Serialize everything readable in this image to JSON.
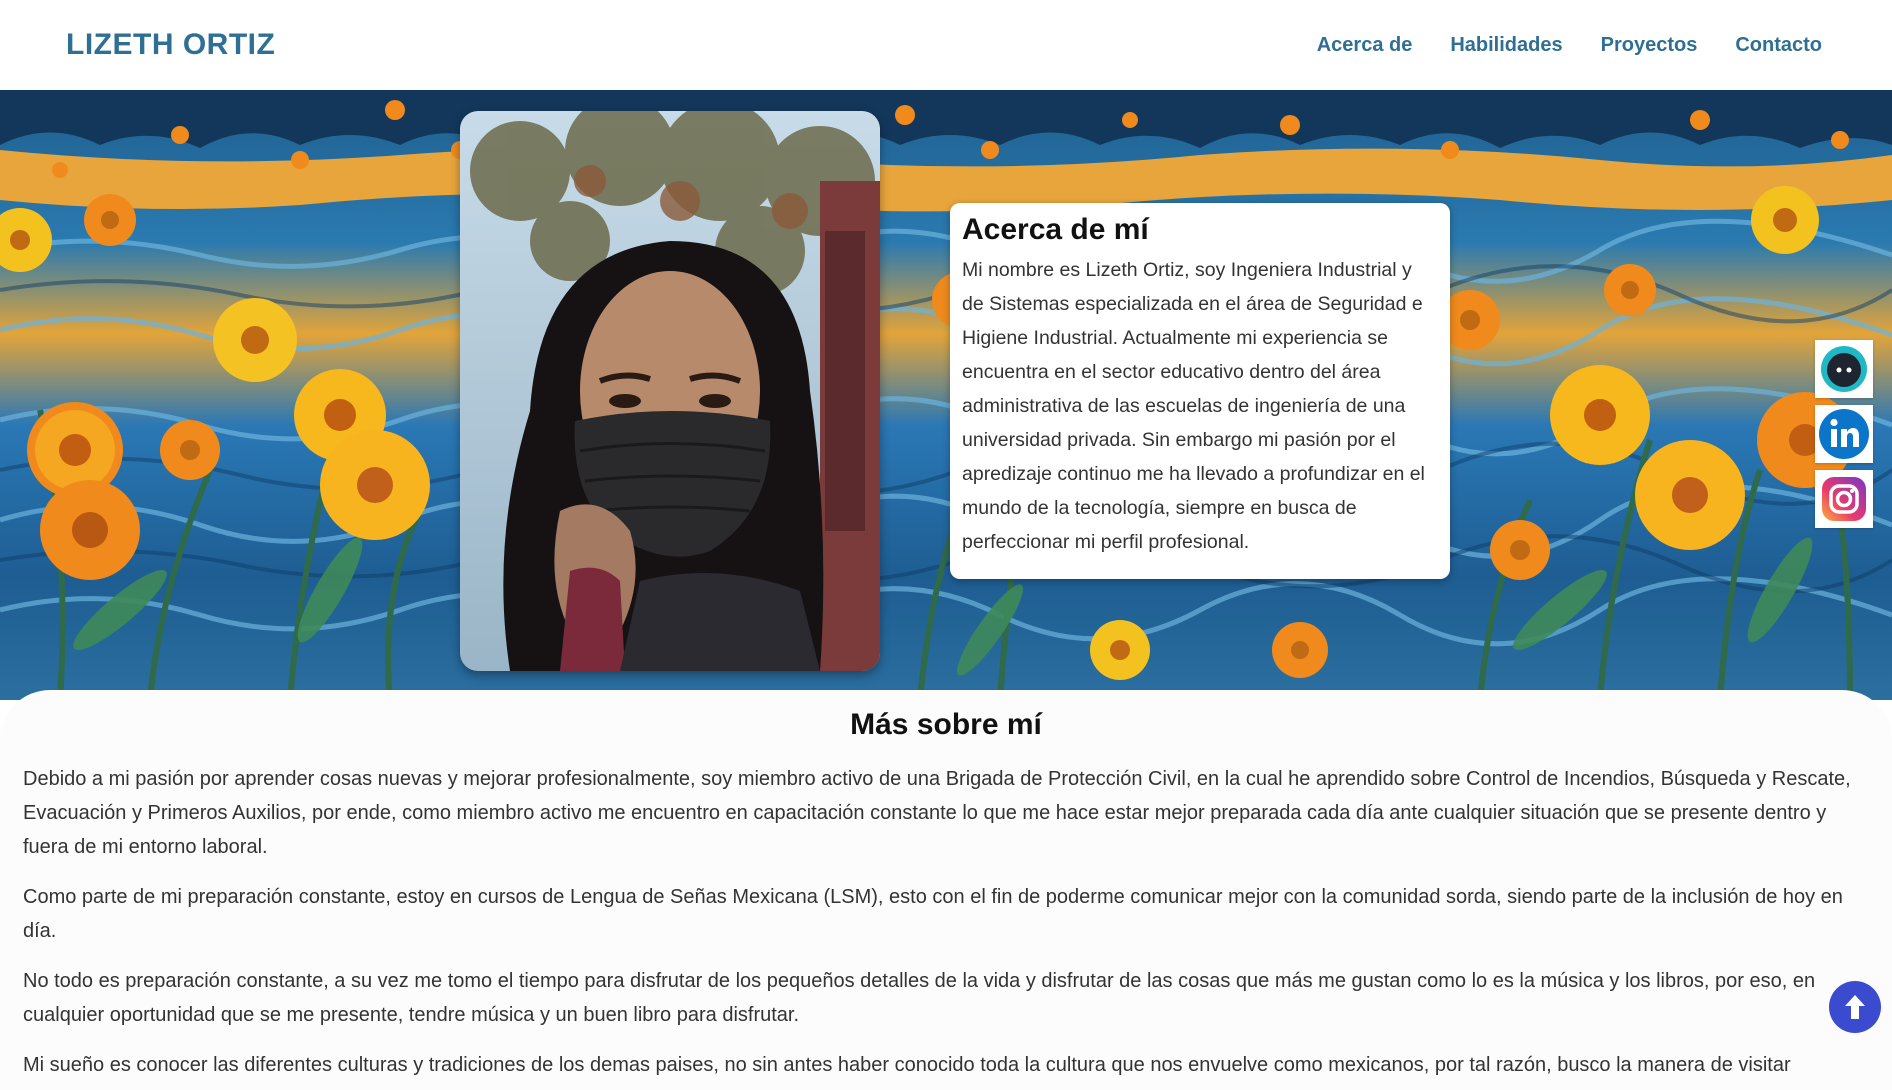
{
  "header": {
    "brand": "LIZETH ORTIZ",
    "nav": [
      "Acerca de",
      "Habilidades",
      "Proyectos",
      "Contacto"
    ]
  },
  "about": {
    "title": "Acerca de mí",
    "text": "Mi nombre es Lizeth Ortiz, soy Ingeniera Industrial y de Sistemas especializada en el área de Seguridad e Higiene Industrial. Actualmente mi experiencia se encuentra en el sector educativo dentro del área administrativa de las escuelas de ingeniería de una universidad privada. Sin embargo mi pasión por el apredizaje continuo me ha llevado a profundizar en el mundo de la tecnología, siempre en busca de perfeccionar mi perfil profesional."
  },
  "more": {
    "title": "Más sobre mí",
    "paragraphs": [
      "Debido a mi pasión por aprender cosas nuevas y mejorar profesionalmente, soy miembro activo de una Brigada de Protección Civil, en la cual he aprendido sobre Control de Incendios, Búsqueda y Rescate, Evacuación y Primeros Auxilios, por ende, como miembro activo me encuentro en capacitación constante lo que me hace estar mejor preparada cada día ante cualquier situación que se presente dentro y fuera de mi entorno laboral.",
      "Como parte de mi preparación constante, estoy en cursos de Lengua de Señas Mexicana (LSM), esto con el fin de poderme comunicar mejor con la comunidad sorda, siendo parte de la inclusión de hoy en día.",
      "No todo es preparación constante, a su vez me tomo el tiempo para disfrutar de los pequeños detalles de la vida y disfrutar de las cosas que más me gustan como lo es la música y los libros, por eso, en cualquier oportunidad que se me presente, tendre música y un buen libro para disfrutar.",
      "Mi sueño es conocer las diferentes culturas y tradiciones de los demas paises, no sin antes haber conocido toda la cultura que nos envuelve como mexicanos, por tal razón, busco la manera de visitar"
    ]
  },
  "social": [
    "github-icon",
    "linkedin-icon",
    "instagram-icon"
  ],
  "colors": {
    "brand": "#2f6f94",
    "scroll_button": "#3a4bd0"
  }
}
